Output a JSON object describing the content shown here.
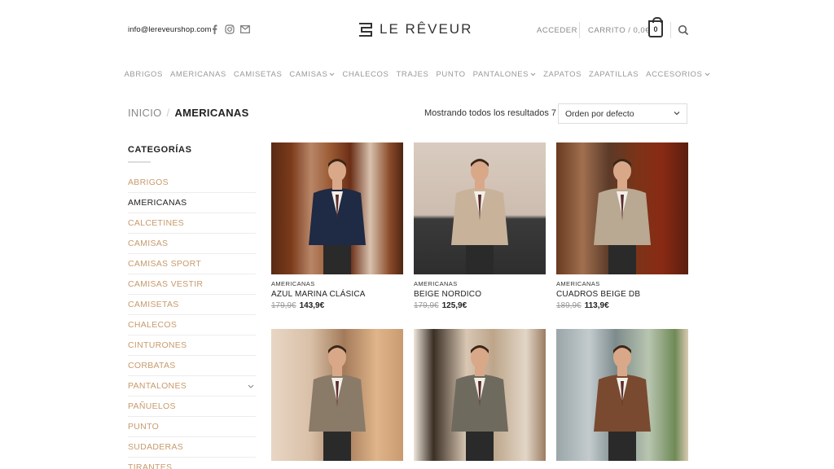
{
  "header": {
    "email": "info@lereveurshop.com",
    "logo_text": "LE RÊVEUR",
    "login": "ACCEDER",
    "cart_label": "CARRITO / 0,0€",
    "cart_count": "0"
  },
  "nav": [
    {
      "label": "ABRIGOS",
      "dropdown": false
    },
    {
      "label": "AMERICANAS",
      "dropdown": false
    },
    {
      "label": "CAMISETAS",
      "dropdown": false
    },
    {
      "label": "CAMISAS",
      "dropdown": true
    },
    {
      "label": "CHALECOS",
      "dropdown": false
    },
    {
      "label": "TRAJES",
      "dropdown": false
    },
    {
      "label": "PUNTO",
      "dropdown": false
    },
    {
      "label": "PANTALONES",
      "dropdown": true
    },
    {
      "label": "ZAPATOS",
      "dropdown": false
    },
    {
      "label": "ZAPATILLAS",
      "dropdown": false
    },
    {
      "label": "ACCESORIOS",
      "dropdown": true
    }
  ],
  "breadcrumb": {
    "home": "INICIO",
    "separator": "/",
    "current": "AMERICANAS"
  },
  "results_text": "Mostrando todos los resultados 7",
  "sort": {
    "selected": "Orden por defecto"
  },
  "sidebar": {
    "title": "CATEGORÍAS",
    "items": [
      {
        "label": "ABRIGOS",
        "active": false,
        "expandable": false
      },
      {
        "label": "AMERICANAS",
        "active": true,
        "expandable": false
      },
      {
        "label": "CALCETINES",
        "active": false,
        "expandable": false
      },
      {
        "label": "CAMISAS",
        "active": false,
        "expandable": false
      },
      {
        "label": "CAMISAS SPORT",
        "active": false,
        "expandable": false
      },
      {
        "label": "CAMISAS VESTIR",
        "active": false,
        "expandable": false
      },
      {
        "label": "CAMISETAS",
        "active": false,
        "expandable": false
      },
      {
        "label": "CHALECOS",
        "active": false,
        "expandable": false
      },
      {
        "label": "CINTURONES",
        "active": false,
        "expandable": false
      },
      {
        "label": "CORBATAS",
        "active": false,
        "expandable": false
      },
      {
        "label": "PANTALONES",
        "active": false,
        "expandable": true
      },
      {
        "label": "PAÑUELOS",
        "active": false,
        "expandable": false
      },
      {
        "label": "PUNTO",
        "active": false,
        "expandable": false
      },
      {
        "label": "SUDADERAS",
        "active": false,
        "expandable": false
      },
      {
        "label": "TIRANTES",
        "active": false,
        "expandable": false
      }
    ]
  },
  "products": [
    {
      "category": "AMERICANAS",
      "name": "AZUL MARINA CLÁSICA",
      "old_price": "179,9€",
      "price": "143,9€",
      "jacket": "#1f2a44",
      "bg": "bg-door"
    },
    {
      "category": "AMERICANAS",
      "name": "BEIGE NORDICO",
      "old_price": "179,9€",
      "price": "125,9€",
      "jacket": "#c8b39a",
      "bg": "bg-wall"
    },
    {
      "category": "AMERICANAS",
      "name": "CUADROS BEIGE DB",
      "old_price": "189,9€",
      "price": "113,9€",
      "jacket": "#b9a892",
      "bg": "bg-door2"
    },
    {
      "category": "",
      "name": "",
      "old_price": "",
      "price": "",
      "jacket": "#8a7a68",
      "bg": "bg-street1"
    },
    {
      "category": "",
      "name": "",
      "old_price": "",
      "price": "",
      "jacket": "#6e6a5e",
      "bg": "bg-street2"
    },
    {
      "category": "",
      "name": "",
      "old_price": "",
      "price": "",
      "jacket": "#7a4a30",
      "bg": "bg-street3"
    }
  ],
  "colors": {
    "accent": "#c79b6d",
    "text": "#222222",
    "muted": "#999999"
  }
}
